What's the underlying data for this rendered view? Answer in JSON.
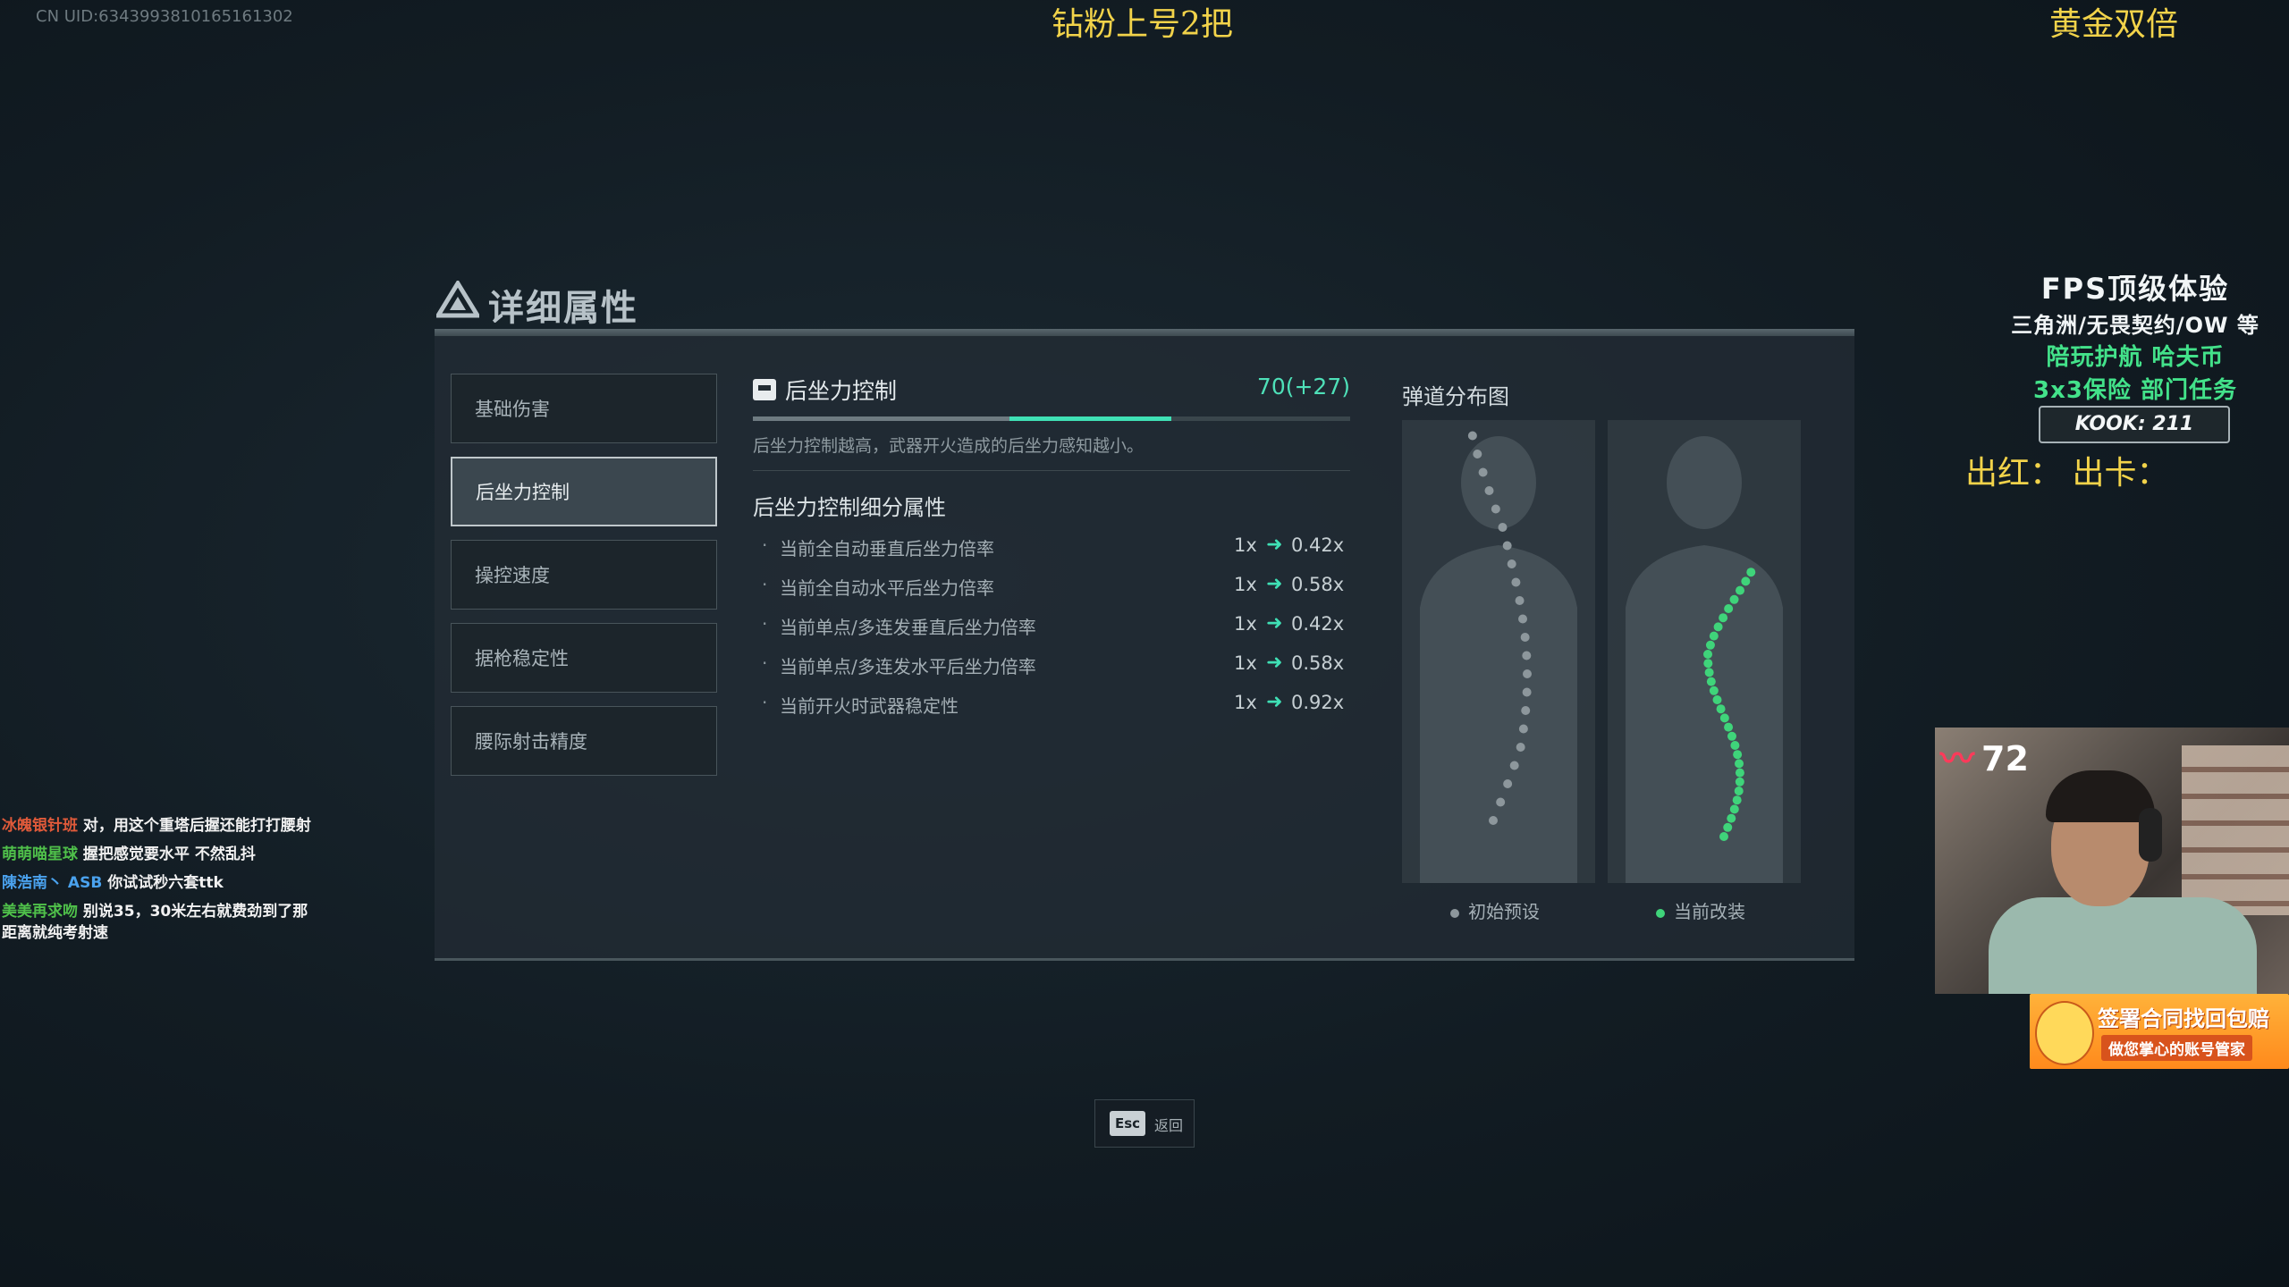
{
  "uid": "CN UID:6343993810165161302",
  "overlay": {
    "top_center": "钻粉上号2把",
    "top_right": "黄金双倍"
  },
  "panel": {
    "title": "详细属性",
    "tabs": [
      "基础伤害",
      "后坐力控制",
      "操控速度",
      "据枪稳定性",
      "腰际射击精度"
    ],
    "active_tab": 1
  },
  "detail": {
    "title": "后坐力控制",
    "value": "70(+27)",
    "base_fraction": 0.43,
    "modified_fraction": 0.7,
    "description": "后坐力控制越高，武器开火造成的后坐力感知越小。",
    "subtitle": "后坐力控制细分属性",
    "rows": [
      {
        "name": "当前全自动垂直后坐力倍率",
        "from": "1x",
        "to": "0.42x"
      },
      {
        "name": "当前全自动水平后坐力倍率",
        "from": "1x",
        "to": "0.58x"
      },
      {
        "name": "当前单点/多连发垂直后坐力倍率",
        "from": "1x",
        "to": "0.42x"
      },
      {
        "name": "当前单点/多连发水平后坐力倍率",
        "from": "1x",
        "to": "0.58x"
      },
      {
        "name": "当前开火时武器稳定性",
        "from": "1x",
        "to": "0.92x"
      }
    ]
  },
  "chart": {
    "title": "弹道分布图",
    "legend_initial": "初始预设",
    "legend_modified": "当前改装",
    "initial_color": "#8d979c",
    "modified_color": "#3fd47a"
  },
  "esc": {
    "key": "Esc",
    "label": "返回"
  },
  "chat": [
    {
      "user": "冰魄银针班",
      "color": "red",
      "msg": "对，用这个重塔后握还能打打腰射"
    },
    {
      "user": "萌萌喵星球",
      "color": "green",
      "msg": "握把感觉要水平 不然乱抖"
    },
    {
      "user": "陳浩南丶 ASB",
      "color": "blue",
      "msg": "你试试秒六套ttk"
    },
    {
      "user": "美美再求吻",
      "color": "green",
      "msg": "别说35，30米左右就费劲到了那距离就纯考射速"
    }
  ],
  "promo": {
    "line1": "FPS顶级体验",
    "line2": "三角洲/无畏契约/OW 等",
    "line3": "陪玩护航  哈夫币",
    "line4": "3x3保险  部门任务",
    "kook": "KOOK: 211",
    "red_card": "出红：   出卡："
  },
  "heart_rate": "72",
  "ad": {
    "line1": "签署合同找回包赔",
    "line2": "做您掌心的账号管家"
  }
}
